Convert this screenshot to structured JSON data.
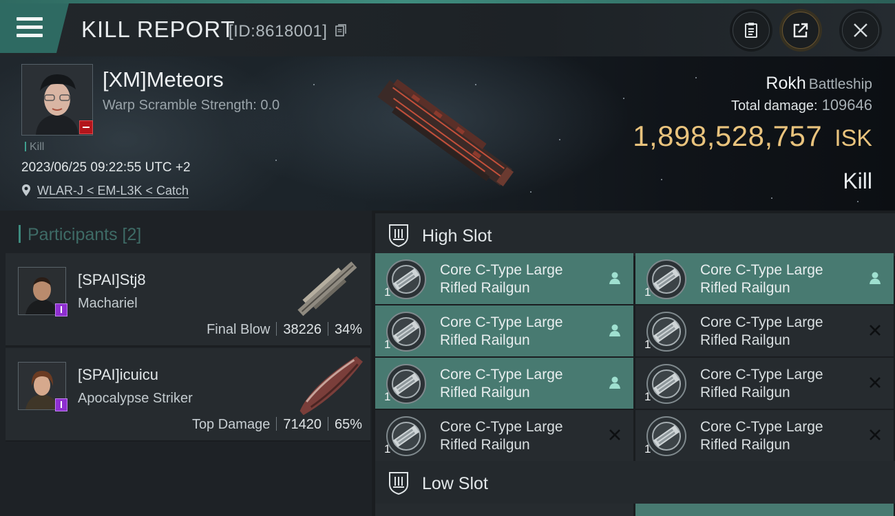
{
  "header": {
    "title": "KILL REPORT",
    "report_id": "[ID:8618001]",
    "buttons": [
      "clipboard-icon",
      "share-icon",
      "close-icon"
    ]
  },
  "victim": {
    "name": "[XM]Meteors",
    "warp_scramble": "Warp Scramble Strength: 0.0",
    "kill_tag": "Kill",
    "datetime": "2023/06/25 09:22:55 UTC +2",
    "location": "WLAR-J < EM-L3K < Catch",
    "ship_name": "Rokh",
    "ship_class": "Battleship",
    "total_damage_label": "Total damage:",
    "total_damage": "109646",
    "isk_value": "1,898,528,757",
    "isk_unit": "ISK",
    "result": "Kill"
  },
  "participants": {
    "title": "Participants [2]",
    "items": [
      {
        "name": "[SPAI]Stj8",
        "ship": "Machariel",
        "role": "Final Blow",
        "damage": "38226",
        "percent": "34%"
      },
      {
        "name": "[SPAI]icuicu",
        "ship": "Apocalypse Striker",
        "role": "Top Damage",
        "damage": "71420",
        "percent": "65%"
      }
    ]
  },
  "fittings": {
    "high_slot_title": "High Slot",
    "low_slot_title": "Low Slot",
    "high_slot_modules": [
      {
        "line1": "Core C-Type Large",
        "line2": "Rifled Railgun",
        "qty": "1",
        "status": "dropped"
      },
      {
        "line1": "Core C-Type Large",
        "line2": "Rifled Railgun",
        "qty": "1",
        "status": "dropped"
      },
      {
        "line1": "Core C-Type Large",
        "line2": "Rifled Railgun",
        "qty": "1",
        "status": "dropped"
      },
      {
        "line1": "Core C-Type Large",
        "line2": "Rifled Railgun",
        "qty": "1",
        "status": "destroyed"
      },
      {
        "line1": "Core C-Type Large",
        "line2": "Rifled Railgun",
        "qty": "1",
        "status": "dropped"
      },
      {
        "line1": "Core C-Type Large",
        "line2": "Rifled Railgun",
        "qty": "1",
        "status": "destroyed"
      },
      {
        "line1": "Core C-Type Large",
        "line2": "Rifled Railgun",
        "qty": "1",
        "status": "destroyed"
      },
      {
        "line1": "Core C-Type Large",
        "line2": "Rifled Railgun",
        "qty": "1",
        "status": "destroyed"
      }
    ]
  },
  "colors": {
    "accent": "#3f8c7e",
    "fitted_bg": "#487a71",
    "isk": "#e9c37d",
    "security_badge": "#b3151b",
    "role_badge": "#8f2fd0"
  }
}
